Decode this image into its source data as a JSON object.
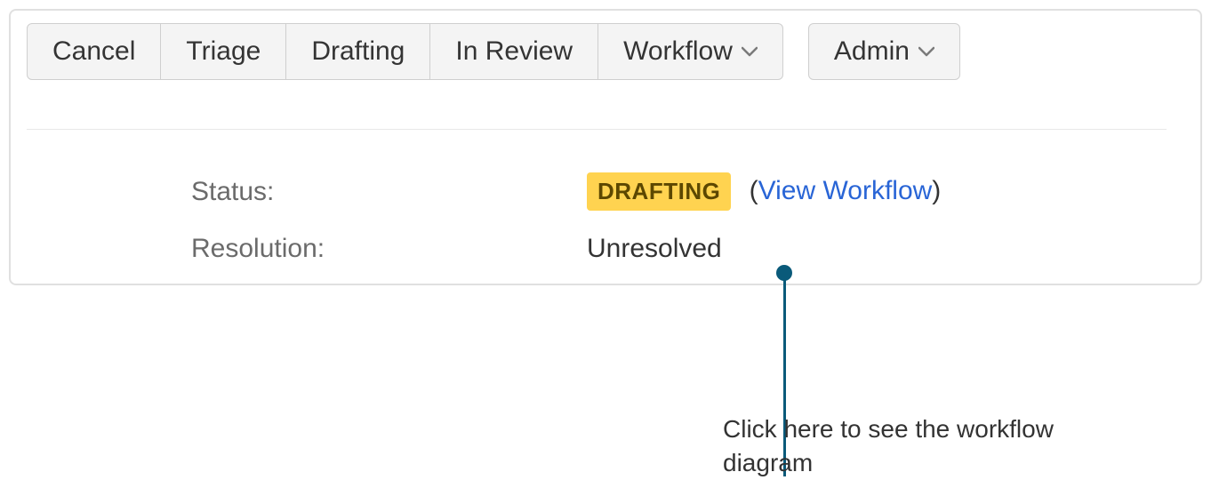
{
  "toolbar": {
    "cancel": "Cancel",
    "triage": "Triage",
    "drafting": "Drafting",
    "in_review": "In Review",
    "workflow": "Workflow",
    "admin": "Admin"
  },
  "details": {
    "status_label": "Status:",
    "status_value": "DRAFTING",
    "view_workflow": "View Workflow",
    "paren_open": "(",
    "paren_close": ")",
    "resolution_label": "Resolution:",
    "resolution_value": "Unresolved"
  },
  "annotation": {
    "text": "Click here to see the workflow diagram"
  }
}
